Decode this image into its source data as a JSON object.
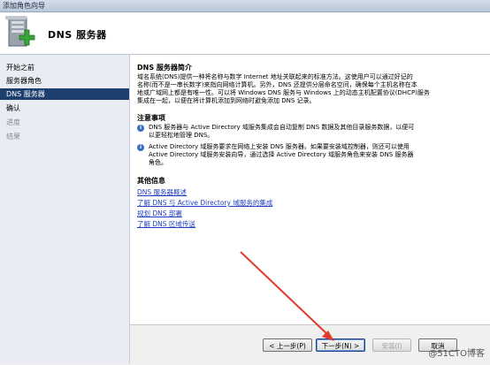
{
  "window": {
    "title": "添加角色向导"
  },
  "header": {
    "title": "DNS 服务器"
  },
  "sidebar": {
    "items": [
      {
        "label": "开始之前",
        "state": "normal"
      },
      {
        "label": "服务器角色",
        "state": "normal"
      },
      {
        "label": "DNS 服务器",
        "state": "active"
      },
      {
        "label": "确认",
        "state": "normal"
      },
      {
        "label": "进度",
        "state": "disabled"
      },
      {
        "label": "结果",
        "state": "disabled"
      }
    ]
  },
  "intro": {
    "title": "DNS 服务器简介",
    "lines": [
      "域名系统(DNS)提供一种将名称与数字 Internet 地址关联起来的标准方法。这使用户可以通过好记的",
      "名称(而不是一串长数字)来指向网络计算机。另外，DNS 还提供分层命名空间，确保每个主机名称在本",
      "地或广域网上都是有唯一性。可以将 Windows DNS 服务与 Windows 上的动态主机配置协议(DHCP)服务",
      "集成在一起，以便在将计算机添加到网络时避免添加 DNS 记录。"
    ]
  },
  "notes": {
    "title": "注意事项",
    "items": [
      {
        "lines": [
          "DNS 服务器与 Active Directory 域服务集成会自动复制 DNS 数据及其他目录服务数据，以便可",
          "以更轻松地管理 DNS。"
        ]
      },
      {
        "lines": [
          "Active Directory 域服务要求在网络上安装 DNS 服务器。如果要安装域控制器，则还可以使用",
          "Active Directory 域服务安装向导，通过选择 Active Directory 域服务角色来安装 DNS 服务器",
          "角色。"
        ]
      }
    ]
  },
  "more_info": {
    "title": "其他信息",
    "links": [
      "DNS 服务器概述",
      "了解 DNS 与 Active Directory 域服务的集成",
      "规划 DNS 部署",
      "了解 DNS 区域传送"
    ]
  },
  "buttons": {
    "back": "< 上一步(P)",
    "next": "下一步(N) >",
    "install": "安装(I)",
    "cancel": "取消"
  },
  "watermark": "@51CTO博客",
  "colors": {
    "nav_active": "#1d3f6e",
    "link": "#1f3fbf",
    "arrow": "#e23b2e"
  },
  "icons": {
    "header": "server-add-icon",
    "note": "info-icon"
  }
}
